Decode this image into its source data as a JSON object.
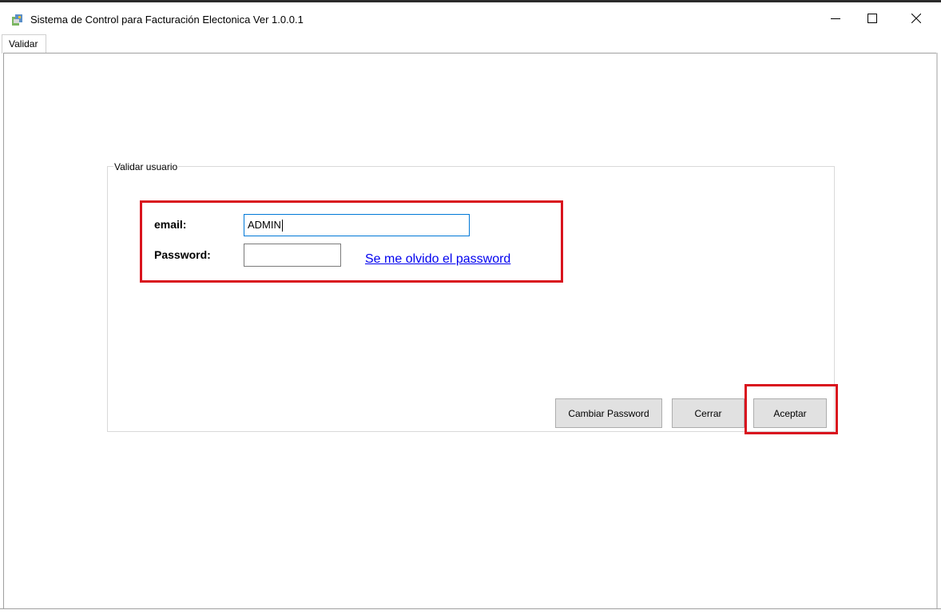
{
  "window": {
    "title": "Sistema de Control para Facturación Electonica  Ver 1.0.0.1",
    "icon": "app-icon",
    "controls": [
      "minimize-icon",
      "maximize-icon",
      "close-icon"
    ]
  },
  "tabs": [
    {
      "label": "Validar",
      "selected": true
    }
  ],
  "group": {
    "legend": "Validar usuario",
    "email_label": "email:",
    "email_value": "ADMIN",
    "password_label": "Password:",
    "password_value": "",
    "forgot_link": "Se me olvido el password"
  },
  "buttons": {
    "change_password": "Cambiar Password",
    "close": "Cerrar",
    "accept": "Aceptar"
  },
  "colors": {
    "highlight": "#d9141e",
    "link": "#0000ee",
    "focus_border": "#0078d7",
    "button_face": "#e1e1e1"
  }
}
